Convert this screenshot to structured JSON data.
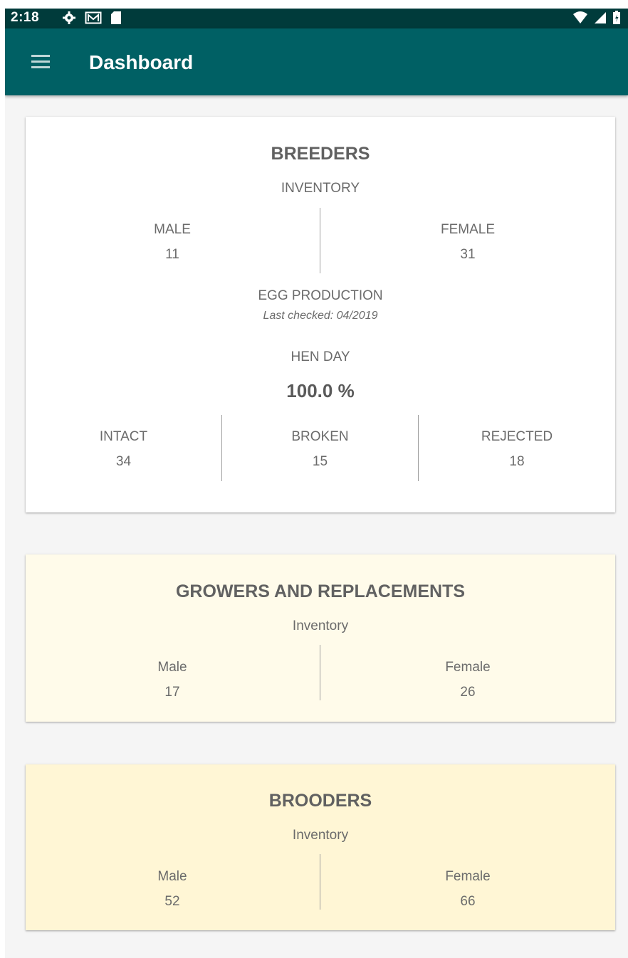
{
  "status_bar": {
    "time": "2:18",
    "left_icons": [
      "gear-icon",
      "gmail-icon",
      "sd-card-icon"
    ],
    "right_icons": [
      "wifi-icon",
      "signal-icon",
      "battery-icon"
    ]
  },
  "app_bar": {
    "title": "Dashboard",
    "menu_icon": "hamburger-menu-icon"
  },
  "colors": {
    "status_bar": "#003b3b",
    "app_bar": "#006064",
    "breeders_card": "#ffffff",
    "growers_card": "#fffbea",
    "brooders_card": "#fff6d5"
  },
  "breeders": {
    "title": "BREEDERS",
    "inventory_label": "INVENTORY",
    "male_label": "MALE",
    "male_value": "11",
    "female_label": "FEMALE",
    "female_value": "31",
    "egg_production_label": "EGG PRODUCTION",
    "last_checked": "Last checked: 04/2019",
    "hen_day_label": "HEN DAY",
    "hen_day_value": "100.0 %",
    "intact_label": "INTACT",
    "intact_value": "34",
    "broken_label": "BROKEN",
    "broken_value": "15",
    "rejected_label": "REJECTED",
    "rejected_value": "18"
  },
  "growers": {
    "title": "GROWERS AND REPLACEMENTS",
    "inventory_label": "Inventory",
    "male_label": "Male",
    "male_value": "17",
    "female_label": "Female",
    "female_value": "26"
  },
  "brooders": {
    "title": "BROODERS",
    "inventory_label": "Inventory",
    "male_label": "Male",
    "male_value": "52",
    "female_label": "Female",
    "female_value": "66"
  }
}
